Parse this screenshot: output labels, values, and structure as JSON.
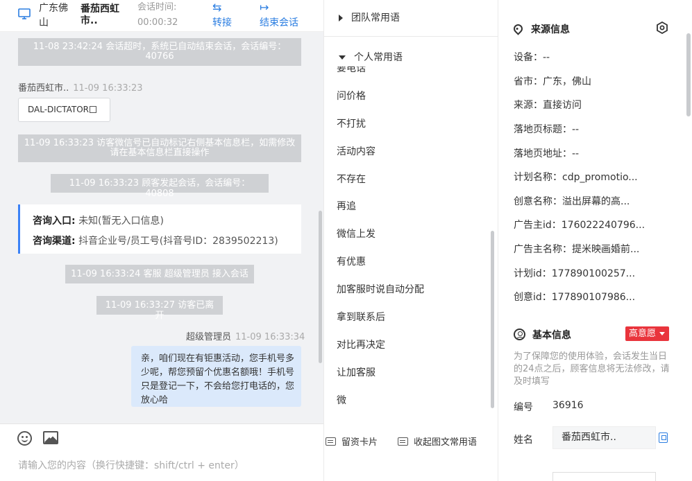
{
  "header": {
    "location": "广东佛山",
    "visitor_name": "番茄西虹市..",
    "session_time_label": "会话时间:",
    "session_time_value": "00:00:32",
    "transfer_label": "转接",
    "end_session_label": "结束会话"
  },
  "chat": {
    "messages": {
      "timeout_notice": "11-08 23:42:24 会话超时，系统已自动结束会话，会话编号：40766",
      "visitor_sender": "番茄西虹市..",
      "visitor_time": "11-09 16:33:23",
      "visitor_chip": "DAL-DICTATOR",
      "wechat_notice": "11-09 16:33:23 访客微信号已自动标记右侧基本信息栏，如需修改请在基本信息栏直接操作",
      "start_notice": "11-09 16:33:23 顾客发起会话，会话编号：40808",
      "entry_label": "咨询入口:",
      "entry_value": "未知(暂无入口信息)",
      "channel_label": "咨询渠道:",
      "channel_value": "抖音企业号/员工号(抖音号ID：2839502213)",
      "agent_join_notice": "11-09 16:33:24 客服 超级管理员 接入会话",
      "visitor_left_notice": "11-09 16:33:27 访客已离开",
      "agent_sender": "超级管理员",
      "agent_time": "11-09 16:33:34",
      "agent_reply": "亲，咱们现在有钜惠活动，您手机号多少呢，帮您预留个优惠名额哦！手机号只是登记一下，不会给您打电话的，您放心哈"
    },
    "composer_placeholder": "请输入您的内容（换行快捷键：shift/ctrl + enter）"
  },
  "phrases": {
    "team_group": "团队常用语",
    "personal_group": "个人常用语",
    "items": [
      "要电话",
      "问价格",
      "不打扰",
      "活动内容",
      "不存在",
      "再追",
      "微信上发",
      "有优惠",
      "加客服时说自动分配",
      "拿到联系后",
      "对比再决定",
      "让加客服",
      "微"
    ],
    "leave_card_btn": "留资卡片",
    "collapse_btn": "收起图文常用语"
  },
  "source_info": {
    "title": "来源信息",
    "rows": [
      "设备：--",
      "省市：广东，佛山",
      "来源：直接访问",
      "落地页标题：--",
      "落地页地址：--",
      "计划名称：cdp_promotio...",
      "创意名称：溢出屏幕的高...",
      "广告主id：176022240796...",
      "广告主名称：提米映画婚前...",
      "计划id：177890100257...",
      "创意id：177890107986..."
    ]
  },
  "basic_info": {
    "title": "基本信息",
    "intent_badge": "高意愿",
    "note": "为了保障您的使用体验，会话发生当日的24点之后，顾客信息将无法修改，请及时填写",
    "id_label": "编号",
    "id_value": "36916",
    "name_label": "姓名",
    "name_value": "番茄西虹市.."
  }
}
